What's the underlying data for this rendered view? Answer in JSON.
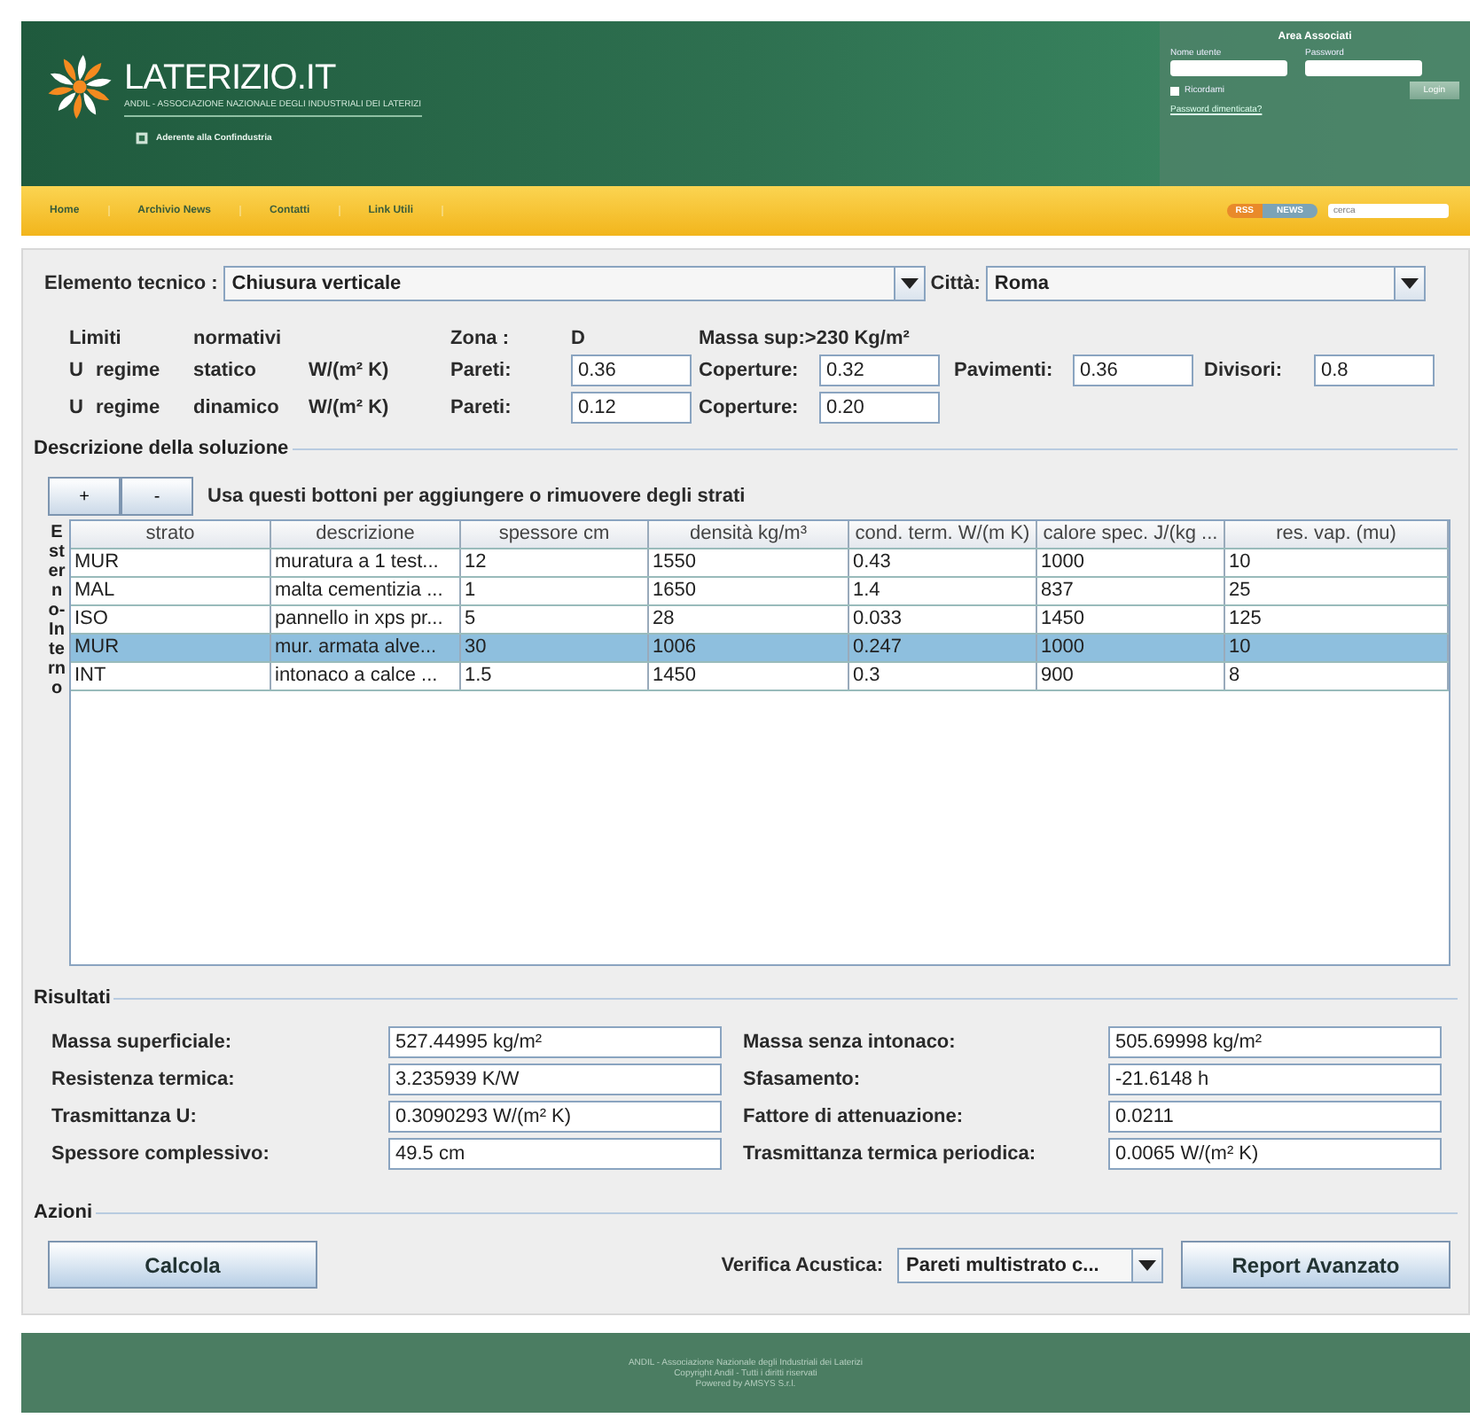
{
  "header": {
    "logo_text": "LATERIZIO.IT",
    "subtitle": "ANDIL - ASSOCIAZIONE NAZIONALE DEGLI INDUSTRIALI DEI LATERIZI",
    "member_note": "Aderente alla Confindustria",
    "login": {
      "title": "Area Associati",
      "username_label": "Nome utente",
      "password_label": "Password",
      "remember_label": "Ricordami",
      "remember": false,
      "button": "Login",
      "forgot_link": "Password dimenticata?"
    }
  },
  "nav": {
    "items": [
      "Home",
      "Archivio News",
      "Contatti",
      "Link Utili"
    ],
    "feed_badge": [
      "RSS",
      "NEWS"
    ],
    "search": {
      "placeholder": "cerca"
    }
  },
  "selectors": [
    {
      "label": "Elemento tecnico :",
      "value": "Chiusura verticale"
    },
    {
      "label": "Città:",
      "value": "Roma"
    }
  ],
  "limits": {
    "title": [
      "Limiti",
      "normativi"
    ],
    "zona_label": "Zona :",
    "zona_value": "D",
    "massa": "Massa sup:>230 Kg/m²",
    "rows": [
      {
        "u": "U",
        "regime": "regime",
        "mode": "statico",
        "unit": "W/(m² K)",
        "fields": [
          {
            "label": "Pareti:",
            "value": "0.36"
          },
          {
            "label": "Coperture:",
            "value": "0.32"
          },
          {
            "label": "Pavimenti:",
            "value": "0.36"
          },
          {
            "label": "Divisori:",
            "value": "0.8"
          }
        ]
      },
      {
        "u": "U",
        "regime": "regime",
        "mode": "dinamico",
        "unit": "W/(m² K)",
        "fields": [
          {
            "label": "Pareti:",
            "value": "0.12"
          },
          {
            "label": "Coperture:",
            "value": "0.20"
          }
        ]
      }
    ]
  },
  "solution": {
    "title": "Descrizione della soluzione",
    "buttons": [
      "+",
      "-"
    ],
    "hint": "Usa questi bottoni per aggiungere o rimuovere degli strati",
    "side_label": "Esterno-Interno",
    "columns": [
      "strato",
      "descrizione",
      "spessore cm",
      "densità kg/m³",
      "cond. term. W/(m K)",
      "calore spec. J/(kg ...",
      "res. vap. (mu)"
    ],
    "rows": [
      {
        "cells": [
          "MUR",
          "muratura a 1 test...",
          "12",
          "1550",
          "0.43",
          "1000",
          "10"
        ],
        "selected": false
      },
      {
        "cells": [
          "MAL",
          "malta cementizia ...",
          "1",
          "1650",
          "1.4",
          "837",
          "25"
        ],
        "selected": false
      },
      {
        "cells": [
          "ISO",
          "pannello in xps pr...",
          "5",
          "28",
          "0.033",
          "1450",
          "125"
        ],
        "selected": false
      },
      {
        "cells": [
          "MUR",
          "mur. armata alve...",
          "30",
          "1006",
          "0.247",
          "1000",
          "10"
        ],
        "selected": true
      },
      {
        "cells": [
          "INT",
          "intonaco a calce ...",
          "1.5",
          "1450",
          "0.3",
          "900",
          "8"
        ],
        "selected": false
      }
    ]
  },
  "results": {
    "title": "Risultati",
    "items": [
      {
        "label": "Massa superficiale:",
        "value": "527.44995 kg/m²"
      },
      {
        "label": "Massa senza intonaco:",
        "value": "505.69998 kg/m²"
      },
      {
        "label": "Resistenza termica:",
        "value": "3.235939 K/W"
      },
      {
        "label": "Sfasamento:",
        "value": "-21.6148 h"
      },
      {
        "label": "Trasmittanza U:",
        "value": "0.3090293 W/(m² K)"
      },
      {
        "label": "Fattore di attenuazione:",
        "value": "0.0211"
      },
      {
        "label": "Spessore complessivo:",
        "value": "49.5 cm"
      },
      {
        "label": "Trasmittanza termica periodica:",
        "value": "0.0065 W/(m² K)"
      }
    ]
  },
  "actions": {
    "title": "Azioni",
    "calcola": "Calcola",
    "verifica_label": "Verifica Acustica:",
    "verifica_value": "Pareti multistrato c...",
    "report": "Report Avanzato"
  },
  "footer": [
    "ANDIL - Associazione Nazionale degli Industriali dei Laterizi",
    "Copyright Andil - Tutti i diritti riservati",
    "Powered by AMSYS S.r.l."
  ]
}
